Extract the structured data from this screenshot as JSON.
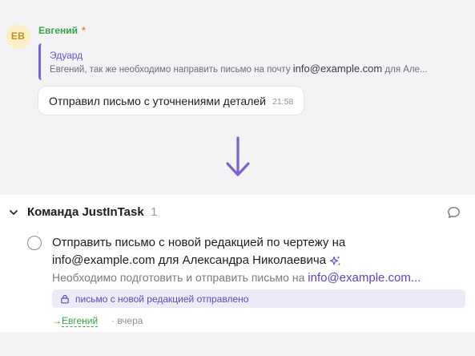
{
  "message": {
    "avatar_initials": "ЕВ",
    "author": "Евгений",
    "author_marker": "*",
    "reply": {
      "author": "Эдуард",
      "text_before": "Евгений, так же необходимо направить письмо на почту ",
      "email": "info@example.com",
      "text_after": " для Але..."
    },
    "text": "Отправил письмо с уточнениями деталей",
    "time": "21:58"
  },
  "team": {
    "title": "Команда JustInTask",
    "count": "1"
  },
  "task": {
    "title_line1": "Отправить письмо с новой редакцией по чертежу на",
    "title_email": "info@example.com",
    "title_rest": " для Александра Николаевича",
    "description_before": "Необходимо подготовить и отправить письмо на ",
    "description_email": "info@example.com...",
    "tag": "письмо с новой редакцией отправлено",
    "assignee_arrow": "→",
    "assignee": "Евгений",
    "date": "· вчера"
  },
  "colors": {
    "accent": "#7b5fd6",
    "author_green": "#3aa24a",
    "tag_bg": "#ecebf8"
  },
  "icons": [
    "down-arrow-icon",
    "chevron-down-icon",
    "comment-icon",
    "sparkle-icon",
    "lock-icon"
  ]
}
